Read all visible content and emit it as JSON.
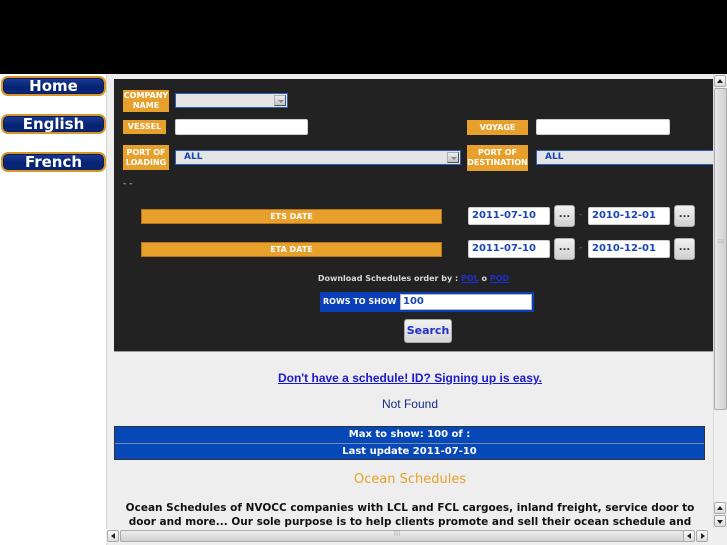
{
  "nav": {
    "home": "Home",
    "english": "English",
    "french": "French"
  },
  "form": {
    "company_name_label": "COMPANY NAME",
    "company_name_value": "",
    "vessel_label": "VESSEL",
    "vessel_value": "",
    "voyage_label": "VOYAGE",
    "voyage_value": "",
    "port_loading_label": "PORT OF LOADING",
    "port_loading_value": "ALL",
    "port_destination_label": "PORT OF DESTINATION",
    "port_destination_value": "ALL",
    "dashes": "- -",
    "ets_label": "ETS DATE",
    "ets_from": "2011-07-10",
    "ets_to": "2010-12-01",
    "eta_label": "ETA DATE",
    "eta_from": "2011-07-10",
    "eta_to": "2010-12-01",
    "date_picker_label": "...",
    "date_separator": "-",
    "download_text": "Download Schedules order by : ",
    "download_pol": "POL",
    "download_or": " o ",
    "download_pod": "POD",
    "rows_label": "ROWS TO SHOW",
    "rows_value": "100",
    "search_label": "Search"
  },
  "results": {
    "signup_link": "Don't have a schedule! ID? Signing up is easy.",
    "status": "Not Found",
    "max_to_show": "Max to show: 100 of :",
    "last_update": "Last update 2011-07-10"
  },
  "about": {
    "title": "Ocean Schedules",
    "description": "Ocean Schedules of NVOCC companies with LCL and FCL cargoes, inland freight, service door to door and more... Our sole purpose is to help clients promote and sell their ocean schedule and"
  },
  "colors": {
    "accent_orange": "#e8a02c",
    "panel_dark": "#222222",
    "info_blue": "#0648b8"
  }
}
